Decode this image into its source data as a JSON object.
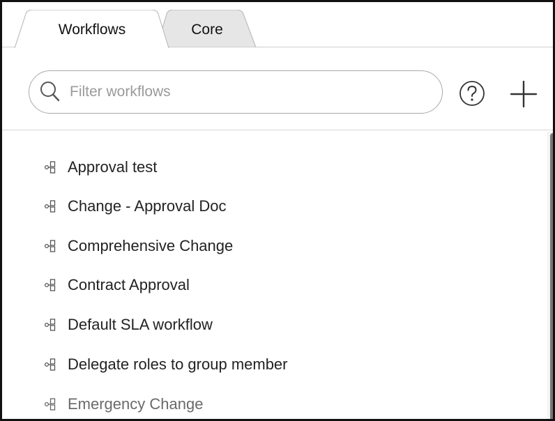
{
  "tabs": [
    {
      "label": "Workflows",
      "active": true
    },
    {
      "label": "Core",
      "active": false
    }
  ],
  "search": {
    "placeholder": "Filter workflows",
    "value": ""
  },
  "toolbar": {
    "help_icon": "help-circle-icon",
    "add_icon": "plus-icon"
  },
  "workflows": [
    {
      "label": "Approval test"
    },
    {
      "label": "Change - Approval Doc"
    },
    {
      "label": "Comprehensive Change"
    },
    {
      "label": "Contract Approval"
    },
    {
      "label": "Default SLA workflow"
    },
    {
      "label": "Delegate roles to group member"
    },
    {
      "label": "Emergency Change"
    }
  ],
  "colors": {
    "border": "#111111",
    "tab_active_bg": "#ffffff",
    "tab_inactive_bg": "#e6e6e6",
    "text": "#222222",
    "placeholder": "#9a9a9a",
    "scrollbar_thumb": "#777777"
  }
}
